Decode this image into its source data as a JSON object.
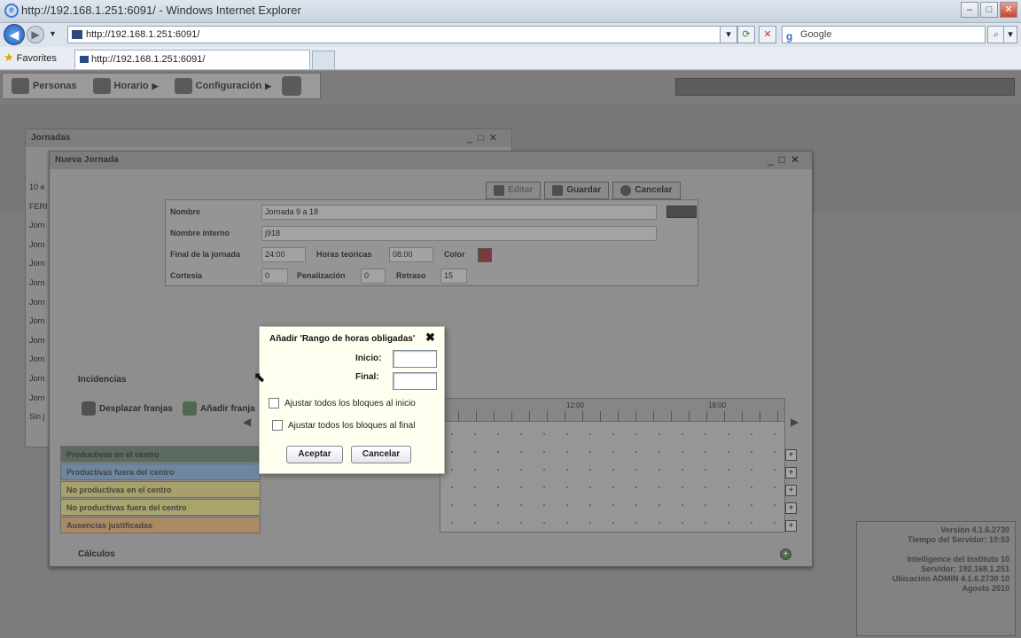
{
  "browser": {
    "title": "http://192.168.1.251:6091/ - Windows Internet Explorer",
    "address": "http://192.168.1.251:6091/",
    "search_placeholder": "Google",
    "favorites_label": "Favorites",
    "tab_label": "http://192.168.1.251:6091/",
    "window_buttons": [
      "–",
      "□",
      "✕"
    ]
  },
  "menu": {
    "items": [
      {
        "label": "Personas",
        "icon": "people-icon"
      },
      {
        "label": "Horario",
        "icon": "clock-icon"
      },
      {
        "label": "Configuración",
        "icon": "wrench-icon"
      }
    ]
  },
  "jornadas": {
    "title": "Jornadas",
    "rows": [
      "10 e",
      "FERI",
      "Jorn",
      "Jorn",
      "Jorn",
      "Jorn",
      "Jorn",
      "Jorn",
      "Jorn",
      "Jorn",
      "Jorn",
      "Jorn",
      "Sin j"
    ]
  },
  "nueva": {
    "title": "Nueva Jornada",
    "actions": {
      "editar": "Editar",
      "guardar": "Guardar",
      "cancelar": "Cancelar"
    },
    "form": {
      "nombre_label": "Nombre",
      "nombre_value": "Jornada 9 a 18",
      "nombre_interno_label": "Nombre interno",
      "nombre_interno_value": "j918",
      "final_label": "Final de la jornada",
      "final_value": "24:00",
      "horas_label": "Horas teoricas",
      "horas_value": "08:00",
      "color_label": "Color",
      "cortesia_label": "Cortesia",
      "cortesia_value": "0",
      "penalizacion_label": "Penalización",
      "penalizacion_value": "0",
      "retraso_label": "Retraso",
      "retraso_value": "15"
    },
    "incidencias_label": "Incidencias",
    "desplazar_label": "Desplazar franjas",
    "anadir_label": "Añadir franja",
    "calculos_label": "Cálculos",
    "grid_times": [
      "12:00",
      "18:00"
    ],
    "categories": [
      {
        "label": "Productivas en el centro",
        "color": "#5b6b5f"
      },
      {
        "label": "Productivas fuera del centro",
        "color": "#6f86a3"
      },
      {
        "label": "No productivas en el centro",
        "color": "#a8a06a"
      },
      {
        "label": "No productivas fuera del centro",
        "color": "#a9a36c"
      },
      {
        "label": "Ausencias justificadas",
        "color": "#a98a62"
      }
    ]
  },
  "info": {
    "lines": [
      "Versión 4.1.6.2730",
      "Tiempo del Servidor: 10:53",
      "",
      "Intelligence del Instituto 10",
      "Servidor: 192.168.1.251",
      "Ubicación ADMIN 4.1.6.2730 10",
      "Agosto 2010"
    ]
  },
  "modal": {
    "title": "Añadir 'Rango de horas obligadas'",
    "inicio_label": "Inicio:",
    "final_label": "Final:",
    "chk_inicio": "Ajustar todos los bloques al inicio",
    "chk_final": "Ajustar todos los bloques al final",
    "aceptar": "Aceptar",
    "cancelar": "Cancelar"
  }
}
